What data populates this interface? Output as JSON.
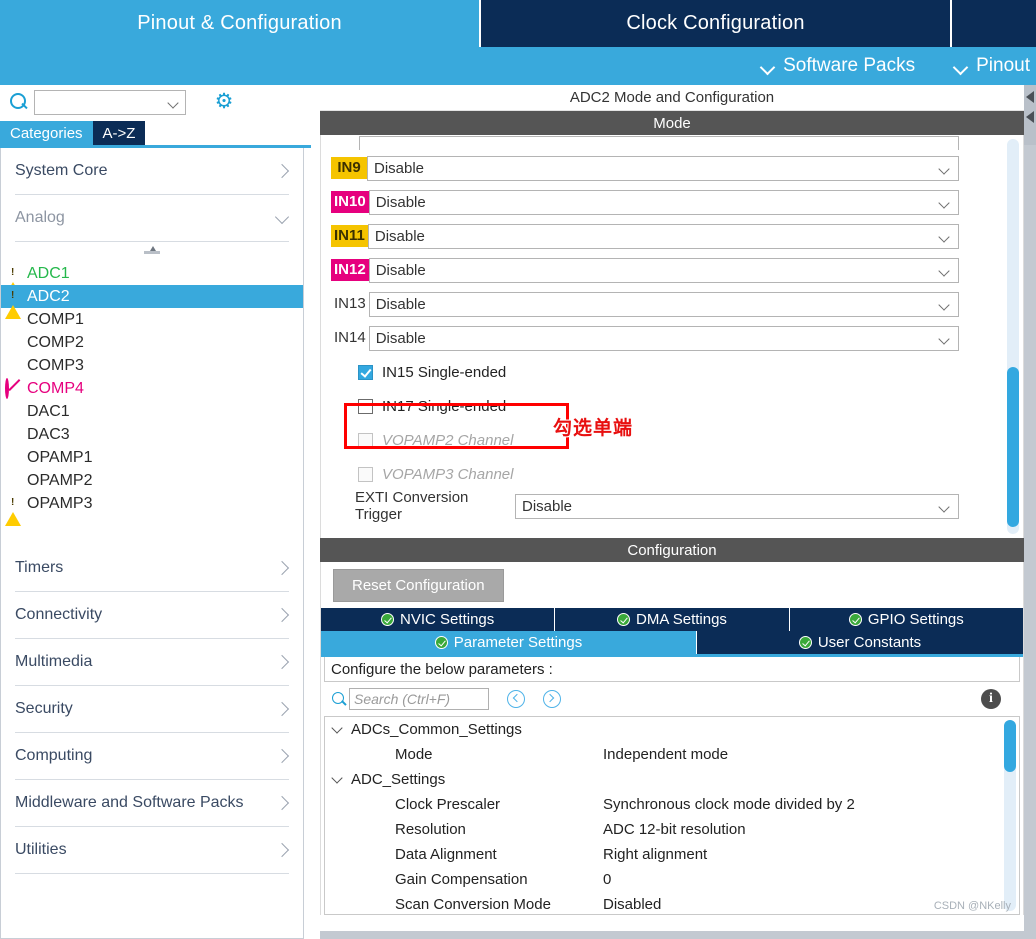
{
  "topbar": {
    "tabs": [
      {
        "label": "Pinout & Configuration",
        "active": true
      },
      {
        "label": "Clock Configuration",
        "active": false
      }
    ]
  },
  "secondbar": {
    "items": [
      {
        "label": "Software Packs",
        "icon": "chevron-down-icon"
      },
      {
        "label": "Pinout",
        "icon": "chevron-down-icon"
      }
    ]
  },
  "sidebar": {
    "search": {
      "value": "",
      "placeholder": ""
    },
    "gear_icon": "gear-icon",
    "subtabs": [
      {
        "label": "Categories",
        "active": true
      },
      {
        "label": "A->Z",
        "active": false
      }
    ],
    "categories": [
      {
        "label": "System Core",
        "state": "collapsed"
      },
      {
        "label": "Analog",
        "state": "expanded"
      }
    ],
    "peripherals": [
      {
        "label": "ADC1",
        "icon": "warning-icon",
        "style": "green"
      },
      {
        "label": "ADC2",
        "icon": "warning-icon",
        "style": "selected"
      },
      {
        "label": "COMP1",
        "icon": "",
        "style": "normal"
      },
      {
        "label": "COMP2",
        "icon": "",
        "style": "normal"
      },
      {
        "label": "COMP3",
        "icon": "",
        "style": "normal"
      },
      {
        "label": "COMP4",
        "icon": "blocked-icon",
        "style": "pink"
      },
      {
        "label": "DAC1",
        "icon": "",
        "style": "normal"
      },
      {
        "label": "DAC3",
        "icon": "",
        "style": "normal"
      },
      {
        "label": "OPAMP1",
        "icon": "",
        "style": "normal"
      },
      {
        "label": "OPAMP2",
        "icon": "",
        "style": "normal"
      },
      {
        "label": "OPAMP3",
        "icon": "warning-icon",
        "style": "normal"
      }
    ],
    "categories_lower": [
      {
        "label": "Timers",
        "state": "collapsed"
      },
      {
        "label": "Connectivity",
        "state": "collapsed"
      },
      {
        "label": "Multimedia",
        "state": "collapsed"
      },
      {
        "label": "Security",
        "state": "collapsed"
      },
      {
        "label": "Computing",
        "state": "collapsed"
      },
      {
        "label": "Middleware and Software Packs",
        "state": "collapsed"
      },
      {
        "label": "Utilities",
        "state": "collapsed"
      }
    ]
  },
  "panel": {
    "title": "ADC2 Mode and Configuration",
    "mode_header": "Mode",
    "channels": [
      {
        "name": "IN9",
        "value": "Disable",
        "tag": "gold"
      },
      {
        "name": "IN10",
        "value": "Disable",
        "tag": "magenta"
      },
      {
        "name": "IN11",
        "value": "Disable",
        "tag": "gold"
      },
      {
        "name": "IN12",
        "value": "Disable",
        "tag": "magenta"
      },
      {
        "name": "IN13",
        "value": "Disable",
        "tag": "none"
      },
      {
        "name": "IN14",
        "value": "Disable",
        "tag": "none"
      }
    ],
    "checkboxes": [
      {
        "label": "IN15 Single-ended",
        "checked": true,
        "disabled": false
      },
      {
        "label": "IN17 Single-ended",
        "checked": false,
        "disabled": false
      },
      {
        "label": "VOPAMP2 Channel",
        "checked": false,
        "disabled": true
      },
      {
        "label": "VOPAMP3 Channel",
        "checked": false,
        "disabled": true
      }
    ],
    "exti": {
      "label": "EXTI Conversion Trigger",
      "value": "Disable"
    }
  },
  "annotation": {
    "text": "勾选单端",
    "color": "#e81010"
  },
  "configuration": {
    "header": "Configuration",
    "reset_label": "Reset Configuration",
    "tabs_row1": [
      {
        "label": "NVIC Settings",
        "active": false,
        "icon": "check-circle-icon"
      },
      {
        "label": "DMA Settings",
        "active": false,
        "icon": "check-circle-icon"
      },
      {
        "label": "GPIO Settings",
        "active": false,
        "icon": "check-circle-icon"
      }
    ],
    "tabs_row2": [
      {
        "label": "Parameter Settings",
        "active": true,
        "icon": "check-circle-icon"
      },
      {
        "label": "User Constants",
        "active": false,
        "icon": "check-circle-icon"
      }
    ],
    "note": "Configure the below parameters :",
    "search": {
      "value": "",
      "placeholder": "Search (Ctrl+F)"
    },
    "nav_prev_icon": "prev-circle-icon",
    "nav_next_icon": "next-circle-icon",
    "info_icon": "info-icon",
    "info_char": "i",
    "parameters": [
      {
        "type": "group",
        "name": "ADCs_Common_Settings",
        "value": ""
      },
      {
        "type": "item",
        "name": "Mode",
        "value": "Independent mode"
      },
      {
        "type": "group",
        "name": "ADC_Settings",
        "value": ""
      },
      {
        "type": "item",
        "name": "Clock Prescaler",
        "value": "Synchronous clock mode divided by 2"
      },
      {
        "type": "item",
        "name": "Resolution",
        "value": "ADC 12-bit resolution"
      },
      {
        "type": "item",
        "name": "Data Alignment",
        "value": "Right alignment"
      },
      {
        "type": "item",
        "name": "Gain Compensation",
        "value": "0"
      },
      {
        "type": "item",
        "name": "Scan Conversion Mode",
        "value": "Disabled"
      }
    ]
  },
  "watermark": "CSDN @NKelly",
  "colors": {
    "accent_blue": "#39a9dc",
    "dark_navy": "#0b2c56",
    "band_gray": "#555555",
    "gold": "#f5c400",
    "magenta": "#e6007e",
    "green": "#25b84c",
    "warning_yellow": "#ffcc00",
    "annotation_red": "#ff0000"
  }
}
